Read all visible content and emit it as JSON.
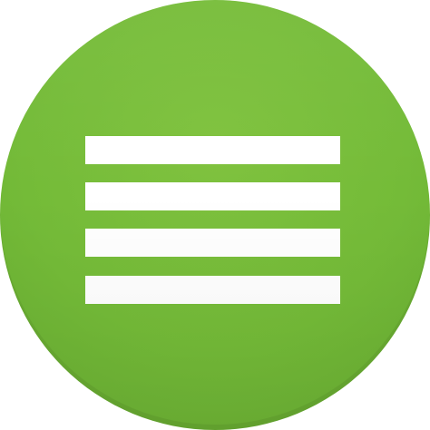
{
  "icon": {
    "name": "hamburger-menu-icon",
    "shape": "circle",
    "background_color": "#76bc39",
    "line_color": "#ffffff",
    "line_count": 4
  }
}
